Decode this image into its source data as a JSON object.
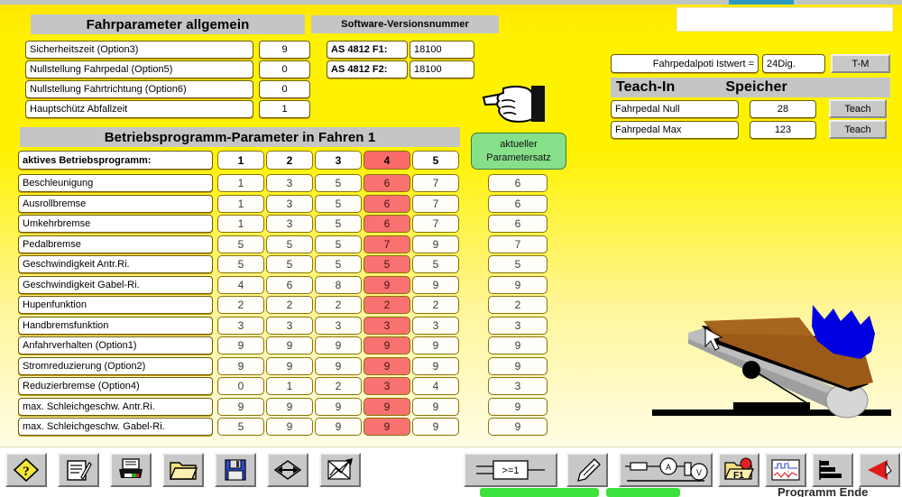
{
  "window": {
    "top_tab_color": "#2E9ABF",
    "background_accent": "#FFF200"
  },
  "panels": {
    "general": {
      "title": "Fahrparameter allgemein",
      "rows": [
        {
          "label": "Sicherheitszeit (Option3)",
          "value": "9"
        },
        {
          "label": "Nullstellung Fahrpedal (Option5)",
          "value": "0"
        },
        {
          "label": "Nullstellung Fahrtrichtung (Option6)",
          "value": "0"
        },
        {
          "label": "Hauptschütz Abfallzeit",
          "value": "1"
        }
      ]
    },
    "software_version": {
      "title": "Software-Versionsnummer",
      "rows": [
        {
          "label": "AS 4812 F1:",
          "value": "18100"
        },
        {
          "label": "AS 4812 F2:",
          "value": "18100"
        }
      ]
    },
    "pedal_poti": {
      "label": "Fahrpedalpoti Istwert =",
      "value": "24Dig.",
      "button": "T-M"
    },
    "teach_in": {
      "title_left": "Teach-In",
      "title_right": "Speicher",
      "rows": [
        {
          "label": "Fahrpedal Null",
          "value": "28",
          "button": "Teach"
        },
        {
          "label": "Fahrpedal Max",
          "value": "123",
          "button": "Teach"
        }
      ]
    },
    "program": {
      "title": "Betriebsprogramm-Parameter in Fahren 1",
      "active_row_label": "aktives Betriebsprogramm:",
      "current_set_button": {
        "line1": "aktueller",
        "line2": "Parametersatz"
      },
      "columns": [
        "1",
        "2",
        "3",
        "4",
        "5"
      ],
      "highlighted_column_index": 3,
      "highlight_color": "#F97272",
      "rows": [
        {
          "label": "Beschleunigung",
          "values": [
            "1",
            "3",
            "5",
            "6",
            "7"
          ],
          "current": "6"
        },
        {
          "label": "Ausrollbremse",
          "values": [
            "1",
            "3",
            "5",
            "6",
            "7"
          ],
          "current": "6"
        },
        {
          "label": "Umkehrbremse",
          "values": [
            "1",
            "3",
            "5",
            "6",
            "7"
          ],
          "current": "6"
        },
        {
          "label": "Pedalbremse",
          "values": [
            "5",
            "5",
            "5",
            "7",
            "9"
          ],
          "current": "7"
        },
        {
          "label": "Geschwindigkeit  Antr.Ri.",
          "values": [
            "5",
            "5",
            "5",
            "5",
            "5"
          ],
          "current": "5"
        },
        {
          "label": "Geschwindigkeit Gabel-Ri.",
          "values": [
            "4",
            "6",
            "8",
            "9",
            "9"
          ],
          "current": "9"
        },
        {
          "label": "Hupenfunktion",
          "values": [
            "2",
            "2",
            "2",
            "2",
            "2"
          ],
          "current": "2"
        },
        {
          "label": "Handbremsfunktion",
          "values": [
            "3",
            "3",
            "3",
            "3",
            "3"
          ],
          "current": "3"
        },
        {
          "label": "Anfahrverhalten (Option1)",
          "values": [
            "9",
            "9",
            "9",
            "9",
            "9"
          ],
          "current": "9"
        },
        {
          "label": "Stromreduzierung (Option2)",
          "values": [
            "9",
            "9",
            "9",
            "9",
            "9"
          ],
          "current": "9"
        },
        {
          "label": "Reduzierbremse (Option4)",
          "values": [
            "0",
            "1",
            "2",
            "3",
            "4"
          ],
          "current": "3"
        },
        {
          "label": "max. Schleichgeschw.  Antr.Ri.",
          "values": [
            "9",
            "9",
            "9",
            "9",
            "9"
          ],
          "current": "9"
        },
        {
          "label": "max. Schleichgeschw. Gabel-Ri.",
          "values": [
            "5",
            "9",
            "9",
            "9",
            "9"
          ],
          "current": "9"
        }
      ]
    }
  },
  "toolbar": {
    "left_buttons": [
      {
        "name": "help-button",
        "icon": "question-diamond-icon"
      },
      {
        "name": "edit-note-button",
        "icon": "note-pencil-icon"
      },
      {
        "name": "print-button",
        "icon": "printer-icon"
      },
      {
        "name": "open-button",
        "icon": "folder-icon"
      },
      {
        "name": "save-button",
        "icon": "floppy-disk-icon"
      },
      {
        "name": "transfer-button",
        "icon": "arrows-diamond-icon"
      },
      {
        "name": "clear-chart-button",
        "icon": "crossed-chart-icon"
      }
    ],
    "right_buttons": [
      {
        "name": "logic-gate-button",
        "icon": "or-gate-icon",
        "label": ">=1"
      },
      {
        "name": "sensor-button",
        "icon": "sensor-probe-icon"
      },
      {
        "name": "measure-button",
        "icon": "voltmeter-circuit-icon"
      },
      {
        "name": "f1-folder-button",
        "icon": "folder-f1-icon",
        "label": "F1"
      },
      {
        "name": "oscilloscope-button",
        "icon": "waveform-icon"
      },
      {
        "name": "bars-button",
        "icon": "bar-steps-icon"
      },
      {
        "name": "back-button",
        "icon": "red-arrow-left-icon"
      }
    ],
    "bottom_labels": {
      "status_left": "",
      "status_right": "",
      "hint": "Programm Ende"
    }
  },
  "artwork": {
    "hand": "pointing-hand-icon",
    "pedal": "accelerator-pedal-illustration"
  }
}
